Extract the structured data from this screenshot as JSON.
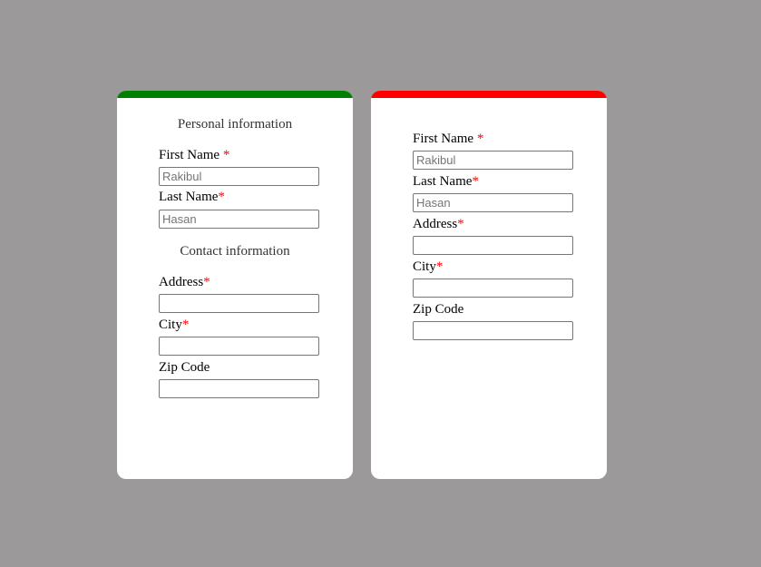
{
  "colors": {
    "card1_accent": "#008000",
    "card2_accent": "#ff0000",
    "required": "#ff0000"
  },
  "card1": {
    "personal_heading": "Personal information",
    "contact_heading": "Contact information",
    "first_name": {
      "label": "First Name ",
      "required": "*",
      "placeholder": "Rakibul",
      "value": ""
    },
    "last_name": {
      "label": "Last Name",
      "required": "*",
      "placeholder": "Hasan",
      "value": ""
    },
    "address": {
      "label": "Address",
      "required": "*",
      "value": ""
    },
    "city": {
      "label": "City",
      "required": "*",
      "value": ""
    },
    "zip": {
      "label": "Zip Code",
      "value": ""
    }
  },
  "card2": {
    "first_name": {
      "label": "First Name ",
      "required": "*",
      "placeholder": "Rakibul",
      "value": ""
    },
    "last_name": {
      "label": "Last Name",
      "required": "*",
      "placeholder": "Hasan",
      "value": ""
    },
    "address": {
      "label": "Address",
      "required": "*",
      "value": ""
    },
    "city": {
      "label": "City",
      "required": "*",
      "value": ""
    },
    "zip": {
      "label": "Zip Code",
      "value": ""
    }
  }
}
